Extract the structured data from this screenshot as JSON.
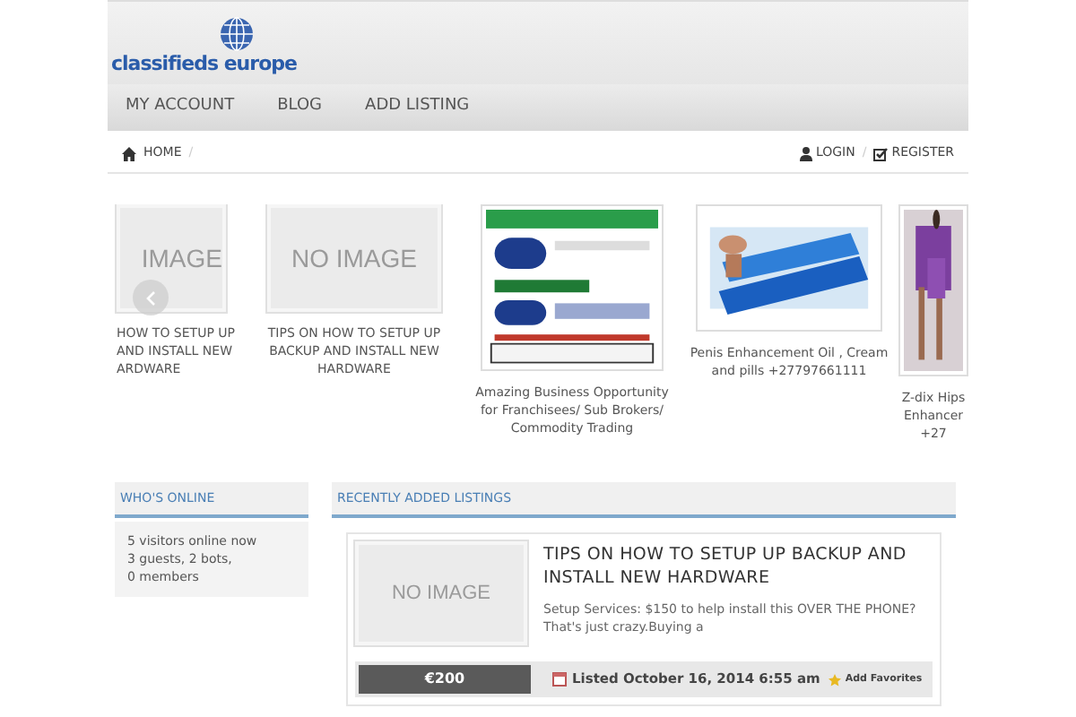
{
  "logo": {
    "text": "classifieds europe"
  },
  "nav": [
    {
      "label": "MY ACCOUNT"
    },
    {
      "label": "BLOG"
    },
    {
      "label": "ADD LISTING"
    }
  ],
  "breadcrumb": {
    "home": "HOME",
    "separator": "/"
  },
  "user_links": [
    {
      "kind": "login",
      "label": "LOGIN"
    },
    {
      "kind": "register",
      "label": "REGISTER"
    }
  ],
  "user_links_separator": "/",
  "carousel": [
    {
      "kind": "noimage",
      "image_text": "IMAGE",
      "caption": [
        "HOW TO SETUP UP",
        "AND INSTALL NEW",
        "ARDWARE"
      ]
    },
    {
      "kind": "noimage",
      "image_text": "NO IMAGE",
      "caption": [
        "TIPS ON HOW TO SETUP UP",
        "BACKUP AND INSTALL NEW",
        "HARDWARE"
      ]
    },
    {
      "kind": "picture",
      "caption": [
        "Amazing Business Opportunity",
        "for Franchisees/ Sub Brokers/",
        "Commodity Trading"
      ]
    },
    {
      "kind": "picture",
      "caption": [
        "Penis Enhancement Oil , Cream",
        "and pills +27797661111"
      ]
    },
    {
      "kind": "picture",
      "caption": [
        "Z-dix Hips",
        "Enhancer",
        "+27"
      ]
    }
  ],
  "whos_online": {
    "title": "WHO'S ONLINE",
    "lines": [
      "5 visitors online now",
      "3 guests, 2 bots,",
      "0 members"
    ]
  },
  "recent": {
    "title": "RECENTLY ADDED LISTINGS",
    "listings": [
      {
        "image_text": "NO IMAGE",
        "title": "TIPS ON HOW TO SETUP UP BACKUP AND INSTALL NEW HARDWARE",
        "excerpt": "Setup Services: $150 to help install this OVER THE PHONE? That's just crazy.Buying a",
        "price": "€200",
        "listed": "Listed October 16, 2014 6:55 am",
        "favorites": "Add Favorites"
      }
    ]
  }
}
